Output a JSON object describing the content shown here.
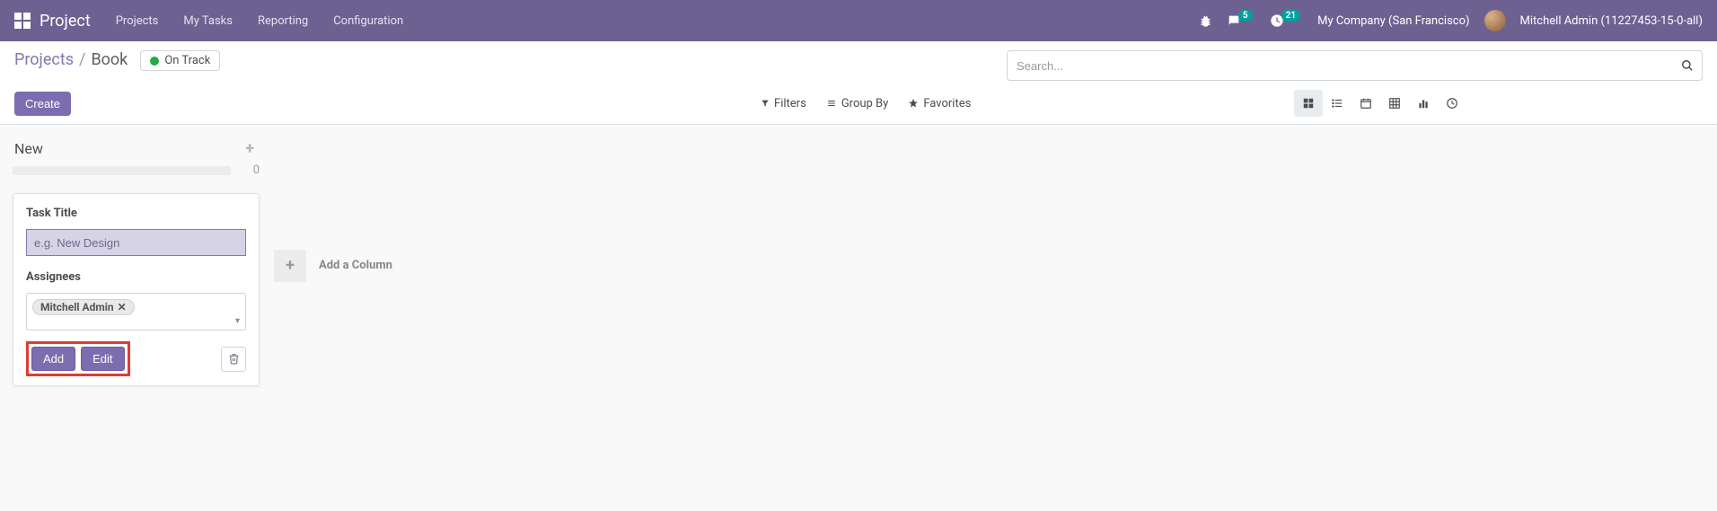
{
  "nav": {
    "brand": "Project",
    "links": [
      "Projects",
      "My Tasks",
      "Reporting",
      "Configuration"
    ],
    "messages_badge": "5",
    "activities_badge": "21",
    "company": "My Company (San Francisco)",
    "user": "Mitchell Admin (11227453-15-0-all)"
  },
  "breadcrumb": {
    "parent": "Projects",
    "current": "Book",
    "status": "On Track"
  },
  "buttons": {
    "create": "Create",
    "add": "Add",
    "edit": "Edit"
  },
  "search": {
    "placeholder": "Search...",
    "filters": "Filters",
    "group_by": "Group By",
    "favorites": "Favorites"
  },
  "kanban": {
    "column_title": "New",
    "column_count": "0",
    "add_column": "Add a Column"
  },
  "quick_create": {
    "task_title_label": "Task Title",
    "task_title_placeholder": "e.g. New Design",
    "assignees_label": "Assignees",
    "assignee_tag": "Mitchell Admin"
  }
}
